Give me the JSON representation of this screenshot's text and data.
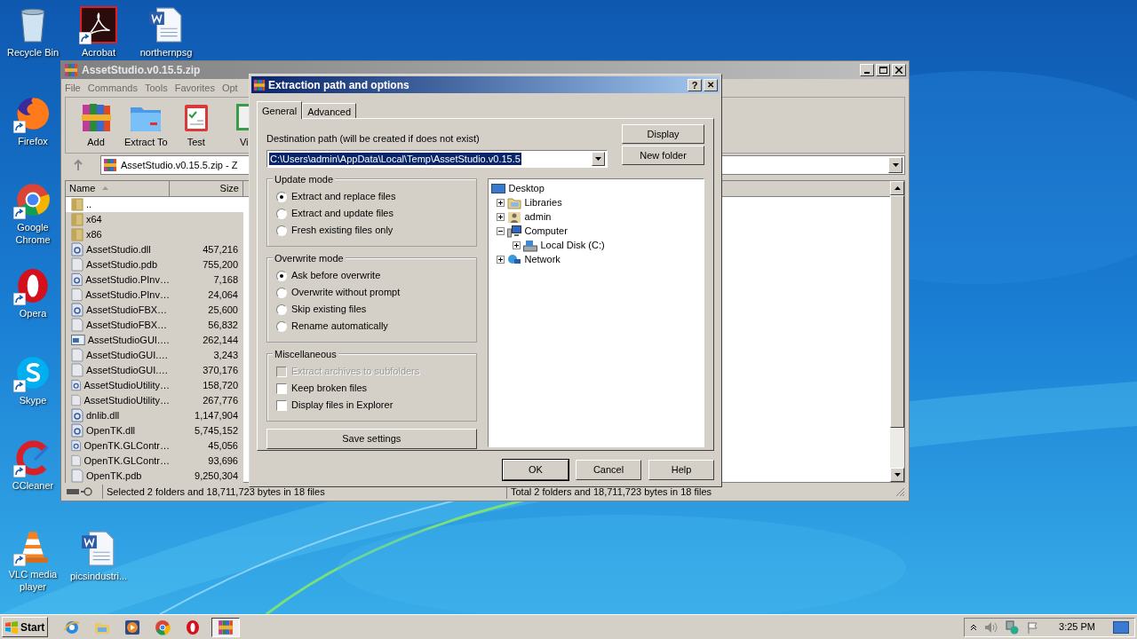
{
  "desktop": {
    "icons": [
      {
        "label": "Recycle Bin",
        "kind": "recycle",
        "shortcut": false
      },
      {
        "label": "Acrobat",
        "kind": "acrobat",
        "shortcut": true
      },
      {
        "label": "northernpsg",
        "kind": "word",
        "shortcut": false
      },
      {
        "label": "Firefox",
        "kind": "firefox",
        "shortcut": true
      },
      {
        "label": "Google Chrome",
        "kind": "chrome",
        "shortcut": true
      },
      {
        "label": "Opera",
        "kind": "opera",
        "shortcut": true
      },
      {
        "label": "Skype",
        "kind": "skype",
        "shortcut": true
      },
      {
        "label": "CCleaner",
        "kind": "ccleaner",
        "shortcut": true
      },
      {
        "label": "VLC media player",
        "kind": "vlc",
        "shortcut": true
      },
      {
        "label": "picsindustri...",
        "kind": "word",
        "shortcut": false
      }
    ]
  },
  "archive_window": {
    "title": "AssetStudio.v0.15.5.zip",
    "menu": [
      "File",
      "Commands",
      "Tools",
      "Favorites",
      "Opt"
    ],
    "toolbar": [
      {
        "label": "Add",
        "kind": "add"
      },
      {
        "label": "Extract To",
        "kind": "extract"
      },
      {
        "label": "Test",
        "kind": "test"
      },
      {
        "label": "Vi",
        "kind": "view"
      }
    ],
    "address": "AssetStudio.v0.15.5.zip - Z",
    "columns": [
      "Name",
      "Size"
    ],
    "rows": [
      {
        "name": "..",
        "kind": "folder",
        "selected": false
      },
      {
        "name": "x64",
        "kind": "folder",
        "selected": true
      },
      {
        "name": "x86",
        "kind": "folder",
        "selected": true
      },
      {
        "name": "AssetStudio.dll",
        "size": "457,216",
        "kind": "dll",
        "selected": true
      },
      {
        "name": "AssetStudio.pdb",
        "size": "755,200",
        "kind": "file",
        "selected": true
      },
      {
        "name": "AssetStudio.PInv…",
        "size": "7,168",
        "kind": "dll",
        "selected": true
      },
      {
        "name": "AssetStudio.PInv…",
        "size": "24,064",
        "kind": "file",
        "selected": true
      },
      {
        "name": "AssetStudioFBX…",
        "size": "25,600",
        "kind": "dll",
        "selected": true
      },
      {
        "name": "AssetStudioFBX…",
        "size": "56,832",
        "kind": "file",
        "selected": true
      },
      {
        "name": "AssetStudioGUI.…",
        "size": "262,144",
        "kind": "app",
        "selected": true
      },
      {
        "name": "AssetStudioGUI.…",
        "size": "3,243",
        "kind": "file",
        "selected": true
      },
      {
        "name": "AssetStudioGUI.…",
        "size": "370,176",
        "kind": "file",
        "selected": true
      },
      {
        "name": "AssetStudioUtility…",
        "size": "158,720",
        "kind": "dll",
        "selected": true
      },
      {
        "name": "AssetStudioUtility…",
        "size": "267,776",
        "kind": "file",
        "selected": true
      },
      {
        "name": "dnlib.dll",
        "size": "1,147,904",
        "kind": "dll",
        "selected": true
      },
      {
        "name": "OpenTK.dll",
        "size": "5,745,152",
        "kind": "dll",
        "selected": true
      },
      {
        "name": "OpenTK.GLContr…",
        "size": "45,056",
        "kind": "dll",
        "selected": true
      },
      {
        "name": "OpenTK.GLContr…",
        "size": "93,696",
        "kind": "file",
        "selected": true
      },
      {
        "name": "OpenTK.pdb",
        "size": "9,250,304",
        "kind": "file",
        "selected": true
      }
    ],
    "status_left": "Selected 2 folders and 18,711,723 bytes in 18 files",
    "status_right": "Total 2 folders and 18,711,723 bytes in 18 files"
  },
  "dialog": {
    "title": "Extraction path and options",
    "help_button": "?",
    "close_button": "✕",
    "tabs": [
      {
        "label": "General",
        "selected": true
      },
      {
        "label": "Advanced",
        "selected": false
      }
    ],
    "destination_label": "Destination path (will be created if does not exist)",
    "destination_value": "C:\\Users\\admin\\AppData\\Local\\Temp\\AssetStudio.v0.15.5",
    "side_buttons": [
      "Display",
      "New folder"
    ],
    "update_mode": {
      "title": "Update mode",
      "options": [
        {
          "label": "Extract and replace files",
          "selected": true
        },
        {
          "label": "Extract and update files",
          "selected": false
        },
        {
          "label": "Fresh existing files only",
          "selected": false
        }
      ]
    },
    "overwrite_mode": {
      "title": "Overwrite mode",
      "options": [
        {
          "label": "Ask before overwrite",
          "selected": true
        },
        {
          "label": "Overwrite without prompt",
          "selected": false
        },
        {
          "label": "Skip existing files",
          "selected": false
        },
        {
          "label": "Rename automatically",
          "selected": false
        }
      ]
    },
    "miscellaneous": {
      "title": "Miscellaneous",
      "options": [
        {
          "label": "Extract archives to subfolders",
          "checked": false,
          "disabled": true
        },
        {
          "label": "Keep broken files",
          "checked": false,
          "disabled": false
        },
        {
          "label": "Display files in Explorer",
          "checked": false,
          "disabled": false
        }
      ]
    },
    "save_button": "Save settings",
    "tree": [
      {
        "label": "Desktop",
        "kind": "desktop",
        "children": [
          {
            "label": "Libraries",
            "kind": "libraries",
            "expanded": false
          },
          {
            "label": "admin",
            "kind": "user",
            "expanded": false
          },
          {
            "label": "Computer",
            "kind": "computer",
            "expanded": true,
            "children": [
              {
                "label": "Local Disk (C:)",
                "kind": "disk",
                "expanded": false
              }
            ]
          },
          {
            "label": "Network",
            "kind": "network",
            "expanded": false
          }
        ]
      }
    ],
    "buttons": [
      "OK",
      "Cancel",
      "Help"
    ]
  },
  "taskbar": {
    "start": "Start",
    "apps": [
      {
        "kind": "ie",
        "active": false
      },
      {
        "kind": "explorer",
        "active": false
      },
      {
        "kind": "media",
        "active": false
      },
      {
        "kind": "chrome",
        "active": false
      },
      {
        "kind": "opera",
        "active": false
      },
      {
        "kind": "winrar",
        "active": true
      }
    ],
    "clock": "3:25 PM"
  }
}
